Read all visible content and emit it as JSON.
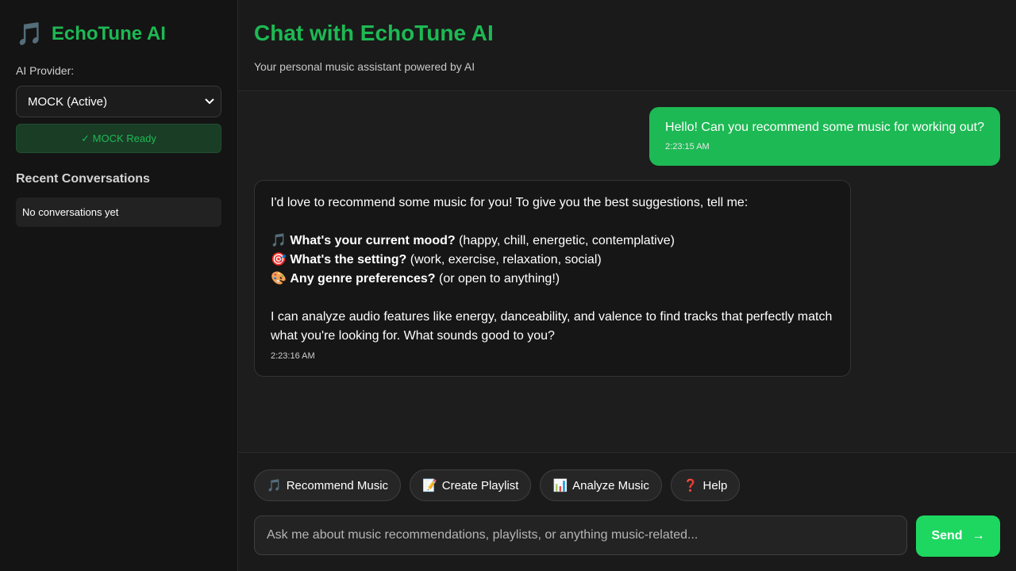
{
  "sidebar": {
    "brand_icon": "music-note",
    "brand_icon_glyph": "🎵",
    "brand_name": "EchoTune AI",
    "provider_label": "AI Provider:",
    "provider_selected": "MOCK (Active)",
    "provider_status": "✓ MOCK Ready",
    "recent_title": "Recent Conversations",
    "recent_empty": "No conversations yet"
  },
  "header": {
    "title": "Chat with EchoTune AI",
    "subtitle": "Your personal music assistant powered by AI"
  },
  "messages": {
    "user": {
      "text": "Hello! Can you recommend some music for working out?",
      "time": "2:23:15 AM"
    },
    "ai": {
      "intro": "I'd love to recommend some music for you! To give you the best suggestions, tell me:",
      "questions": [
        {
          "icon": "🎵",
          "bold": "What's your current mood?",
          "rest": " (happy, chill, energetic, contemplative)"
        },
        {
          "icon": "🎯",
          "bold": "What's the setting?",
          "rest": " (work, exercise, relaxation, social)"
        },
        {
          "icon": "🎨",
          "bold": "Any genre preferences?",
          "rest": " (or open to anything!)"
        }
      ],
      "outro": "I can analyze audio features like energy, danceability, and valence to find tracks that perfectly match what you're looking for. What sounds good to you?",
      "time": "2:23:16 AM"
    }
  },
  "quick_actions": [
    {
      "icon": "🎵",
      "label": "Recommend Music"
    },
    {
      "icon": "📝",
      "label": "Create Playlist"
    },
    {
      "icon": "📊",
      "label": "Analyze Music"
    },
    {
      "icon": "❓",
      "label": "Help"
    }
  ],
  "input": {
    "placeholder": "Ask me about music recommendations, playlists, or anything music-related...",
    "send_label": "Send",
    "send_arrow": "→"
  },
  "colors": {
    "accent": "#1db954",
    "send": "#1ed760",
    "background": "#1a1a1a"
  }
}
